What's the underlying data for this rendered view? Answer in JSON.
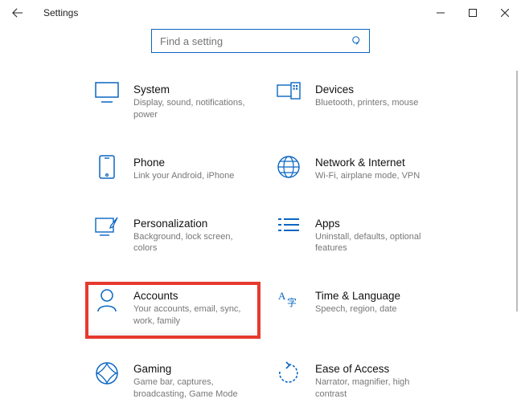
{
  "window": {
    "title": "Settings"
  },
  "search": {
    "placeholder": "Find a setting"
  },
  "items": [
    {
      "name": "System",
      "desc": "Display, sound, notifications, power"
    },
    {
      "name": "Devices",
      "desc": "Bluetooth, printers, mouse"
    },
    {
      "name": "Phone",
      "desc": "Link your Android, iPhone"
    },
    {
      "name": "Network & Internet",
      "desc": "Wi-Fi, airplane mode, VPN"
    },
    {
      "name": "Personalization",
      "desc": "Background, lock screen, colors"
    },
    {
      "name": "Apps",
      "desc": "Uninstall, defaults, optional features"
    },
    {
      "name": "Accounts",
      "desc": "Your accounts, email, sync, work, family"
    },
    {
      "name": "Time & Language",
      "desc": "Speech, region, date"
    },
    {
      "name": "Gaming",
      "desc": "Game bar, captures, broadcasting, Game Mode"
    },
    {
      "name": "Ease of Access",
      "desc": "Narrator, magnifier, high contrast"
    }
  ],
  "colors": {
    "accent": "#0a66c2"
  }
}
